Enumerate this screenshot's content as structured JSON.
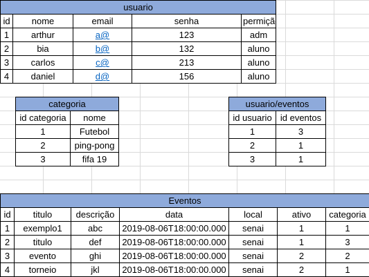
{
  "usuario": {
    "title": "usuario",
    "headers": [
      "id",
      "nome",
      "email",
      "senha",
      "permição"
    ],
    "rows": [
      [
        "1",
        "arthur",
        "a@",
        "123",
        "adm"
      ],
      [
        "2",
        "bia",
        "b@",
        "132",
        "aluno"
      ],
      [
        "3",
        "carlos",
        "c@",
        "213",
        "aluno"
      ],
      [
        "4",
        "daniel",
        "d@",
        "156",
        "aluno"
      ]
    ]
  },
  "categoria": {
    "title": "categoria",
    "headers": [
      "id categoria",
      "nome"
    ],
    "rows": [
      [
        "1",
        "Futebol"
      ],
      [
        "2",
        "ping-pong"
      ],
      [
        "3",
        "fifa 19"
      ]
    ]
  },
  "usuario_eventos": {
    "title": "usuario/eventos",
    "headers": [
      "id usuario",
      "id eventos"
    ],
    "rows": [
      [
        "1",
        "3"
      ],
      [
        "2",
        "1"
      ],
      [
        "3",
        "1"
      ]
    ]
  },
  "eventos": {
    "title": "Eventos",
    "headers": [
      "id",
      "titulo",
      "descrição",
      "data",
      "local",
      "ativo",
      "categoria"
    ],
    "rows": [
      [
        "1",
        "exemplo1",
        "abc",
        "2019-08-06T18:00:00.000",
        "senai",
        "1",
        "1"
      ],
      [
        "2",
        "titulo",
        "def",
        "2019-08-06T18:00:00.000",
        "senai",
        "1",
        "3"
      ],
      [
        "3",
        "evento",
        "ghi",
        "2019-08-06T18:00:00.000",
        "senai",
        "2",
        "2"
      ],
      [
        "4",
        "torneio",
        "jkl",
        "2019-08-06T18:00:00.000",
        "senai",
        "2",
        "1"
      ]
    ]
  },
  "colors": {
    "header_fill": "#8eaadb",
    "link": "#0563c1",
    "gridline": "#dadada"
  }
}
